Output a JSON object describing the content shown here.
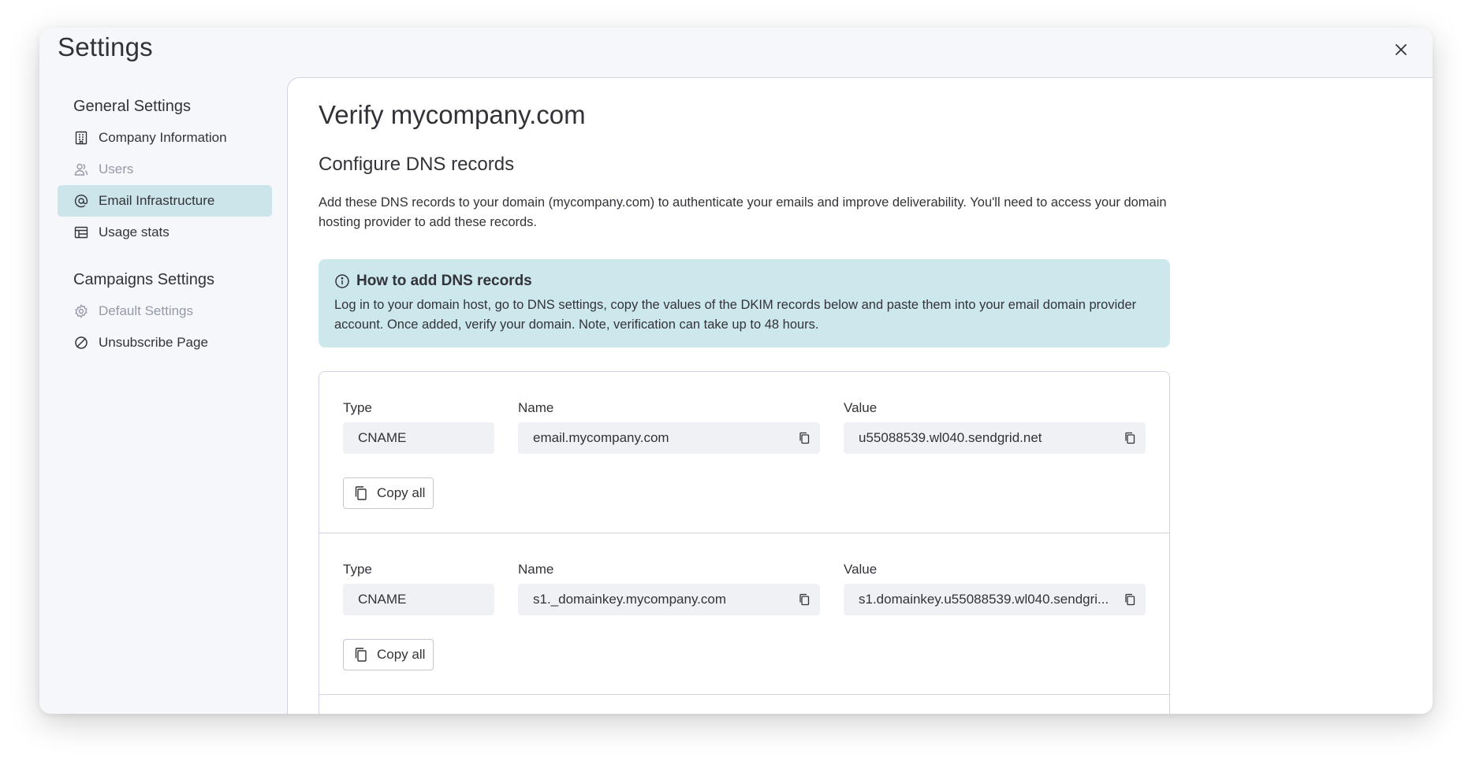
{
  "window": {
    "title": "Settings"
  },
  "sidebar": {
    "general_heading": "General Settings",
    "general_items": [
      {
        "label": "Company Information",
        "icon": "building-icon",
        "state": "normal"
      },
      {
        "label": "Users",
        "icon": "users-icon",
        "state": "disabled"
      },
      {
        "label": "Email Infrastructure",
        "icon": "at-sign-icon",
        "state": "active"
      },
      {
        "label": "Usage stats",
        "icon": "stats-table-icon",
        "state": "normal"
      }
    ],
    "campaigns_heading": "Campaigns Settings",
    "campaign_items": [
      {
        "label": "Default Settings",
        "icon": "gear-icon",
        "state": "disabled"
      },
      {
        "label": "Unsubscribe Page",
        "icon": "prohibited-icon",
        "state": "normal"
      }
    ]
  },
  "main": {
    "title": "Verify mycompany.com",
    "section_title": "Configure DNS records",
    "description": "Add these DNS records to your domain (mycompany.com) to authenticate your emails and improve deliverability. You'll need to access your domain hosting provider to add these records.",
    "info": {
      "heading": "How to add DNS records",
      "text": "Log in to your domain host, go to DNS settings, copy the values of the DKIM records below and paste them into your email domain provider account. Once added, verify your domain. Note, verification can take up to 48 hours."
    },
    "labels": {
      "type": "Type",
      "name": "Name",
      "value": "Value",
      "copy_all": "Copy all"
    },
    "records": [
      {
        "type": "CNAME",
        "name": "email.mycompany.com",
        "value": "u55088539.wl040.sendgrid.net"
      },
      {
        "type": "CNAME",
        "name": "s1._domainkey.mycompany.com",
        "value": "s1.domainkey.u55088539.wl040.sendgri..."
      }
    ]
  },
  "colors": {
    "active_nav": "#cce5ea",
    "info_box": "#cde8ec",
    "field_bg": "#f0f1f4",
    "text": "#323338",
    "disabled_text": "#9699a6"
  }
}
